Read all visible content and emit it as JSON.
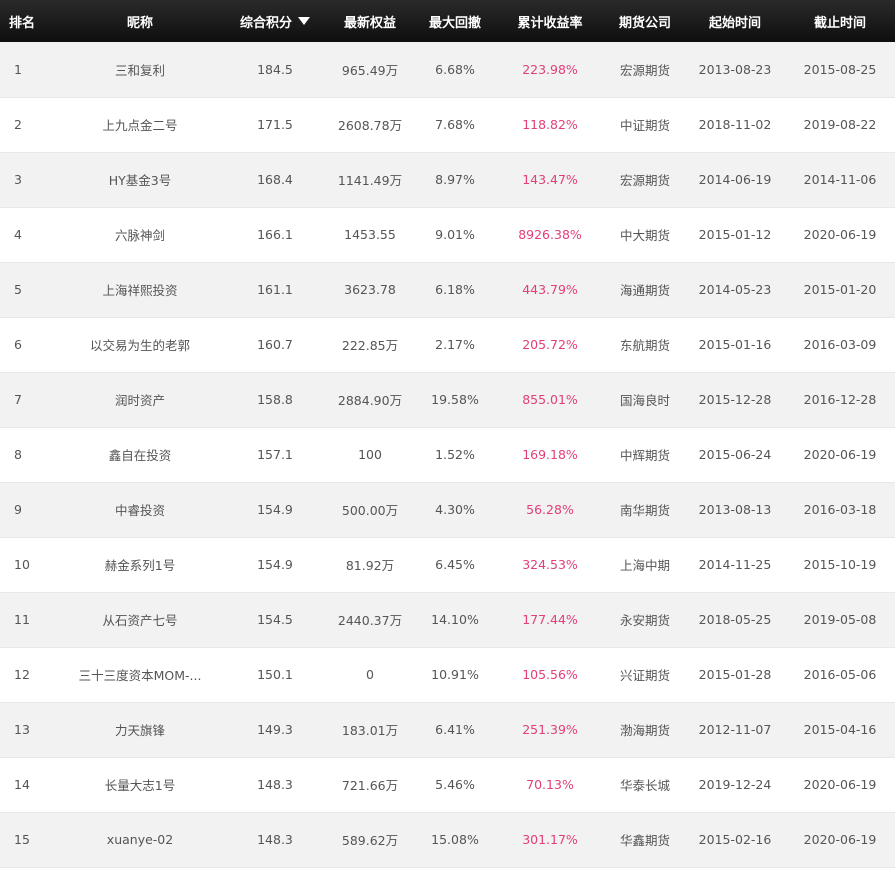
{
  "table": {
    "headers": {
      "rank": "排名",
      "name": "昵称",
      "score": "综合积分",
      "equity": "最新权益",
      "drawdown": "最大回撤",
      "return": "累计收益率",
      "company": "期货公司",
      "start": "起始时间",
      "end": "截止时间"
    },
    "sort_icon": "sort-desc-triangle",
    "colors": {
      "header_bg": "#111111",
      "return_text": "#e33e7a",
      "row_alt": "#f2f2f2"
    },
    "rows": [
      {
        "rank": "1",
        "name": "三和复利",
        "score": "184.5",
        "equity": "965.49万",
        "drawdown": "6.68%",
        "return": "223.98%",
        "company": "宏源期货",
        "start": "2013-08-23",
        "end": "2015-08-25"
      },
      {
        "rank": "2",
        "name": "上九点金二号",
        "score": "171.5",
        "equity": "2608.78万",
        "drawdown": "7.68%",
        "return": "118.82%",
        "company": "中证期货",
        "start": "2018-11-02",
        "end": "2019-08-22"
      },
      {
        "rank": "3",
        "name": "HY基金3号",
        "score": "168.4",
        "equity": "1141.49万",
        "drawdown": "8.97%",
        "return": "143.47%",
        "company": "宏源期货",
        "start": "2014-06-19",
        "end": "2014-11-06"
      },
      {
        "rank": "4",
        "name": "六脉神剑",
        "score": "166.1",
        "equity": "1453.55",
        "drawdown": "9.01%",
        "return": "8926.38%",
        "company": "中大期货",
        "start": "2015-01-12",
        "end": "2020-06-19"
      },
      {
        "rank": "5",
        "name": "上海祥熙投资",
        "score": "161.1",
        "equity": "3623.78",
        "drawdown": "6.18%",
        "return": "443.79%",
        "company": "海通期货",
        "start": "2014-05-23",
        "end": "2015-01-20"
      },
      {
        "rank": "6",
        "name": "以交易为生的老郭",
        "score": "160.7",
        "equity": "222.85万",
        "drawdown": "2.17%",
        "return": "205.72%",
        "company": "东航期货",
        "start": "2015-01-16",
        "end": "2016-03-09"
      },
      {
        "rank": "7",
        "name": "润时资产",
        "score": "158.8",
        "equity": "2884.90万",
        "drawdown": "19.58%",
        "return": "855.01%",
        "company": "国海良时",
        "start": "2015-12-28",
        "end": "2016-12-28"
      },
      {
        "rank": "8",
        "name": "鑫自在投资",
        "score": "157.1",
        "equity": "100",
        "drawdown": "1.52%",
        "return": "169.18%",
        "company": "中辉期货",
        "start": "2015-06-24",
        "end": "2020-06-19"
      },
      {
        "rank": "9",
        "name": "中睿投资",
        "score": "154.9",
        "equity": "500.00万",
        "drawdown": "4.30%",
        "return": "56.28%",
        "company": "南华期货",
        "start": "2013-08-13",
        "end": "2016-03-18"
      },
      {
        "rank": "10",
        "name": "赫金系列1号",
        "score": "154.9",
        "equity": "81.92万",
        "drawdown": "6.45%",
        "return": "324.53%",
        "company": "上海中期",
        "start": "2014-11-25",
        "end": "2015-10-19"
      },
      {
        "rank": "11",
        "name": "从石资产七号",
        "score": "154.5",
        "equity": "2440.37万",
        "drawdown": "14.10%",
        "return": "177.44%",
        "company": "永安期货",
        "start": "2018-05-25",
        "end": "2019-05-08"
      },
      {
        "rank": "12",
        "name": "三十三度资本MOM-...",
        "score": "150.1",
        "equity": "0",
        "drawdown": "10.91%",
        "return": "105.56%",
        "company": "兴证期货",
        "start": "2015-01-28",
        "end": "2016-05-06"
      },
      {
        "rank": "13",
        "name": "力天旗锋",
        "score": "149.3",
        "equity": "183.01万",
        "drawdown": "6.41%",
        "return": "251.39%",
        "company": "渤海期货",
        "start": "2012-11-07",
        "end": "2015-04-16"
      },
      {
        "rank": "14",
        "name": "长量大志1号",
        "score": "148.3",
        "equity": "721.66万",
        "drawdown": "5.46%",
        "return": "70.13%",
        "company": "华泰长城",
        "start": "2019-12-24",
        "end": "2020-06-19"
      },
      {
        "rank": "15",
        "name": "xuanye-02",
        "score": "148.3",
        "equity": "589.62万",
        "drawdown": "15.08%",
        "return": "301.17%",
        "company": "华鑫期货",
        "start": "2015-02-16",
        "end": "2020-06-19"
      }
    ]
  }
}
